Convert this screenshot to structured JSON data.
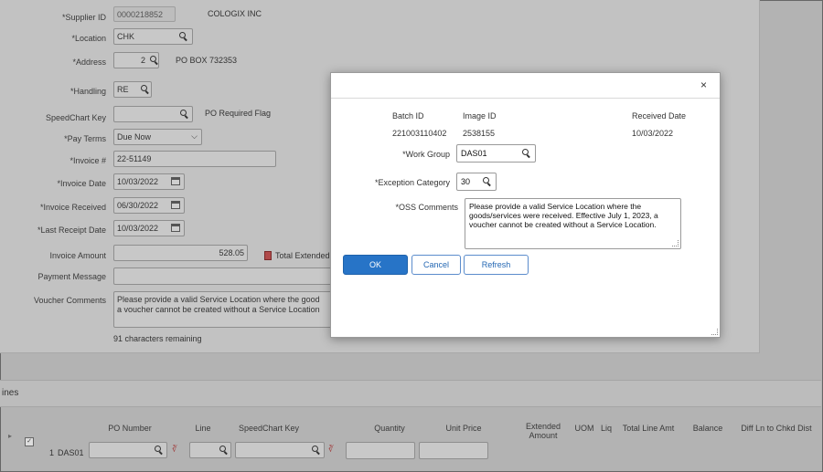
{
  "form": {
    "supplier_id_label": "*Supplier ID",
    "supplier_id": "0000218852",
    "supplier_name": "COLOGIX INC",
    "location_label": "*Location",
    "location": "CHK",
    "address_label": "*Address",
    "address_seq": "2",
    "address_text": "PO BOX 732353",
    "handling_label": "*Handling",
    "handling": "RE",
    "speedchart_label": "SpeedChart Key",
    "speedchart": "",
    "po_required_flag": "PO Required Flag",
    "pay_terms_label": "*Pay Terms",
    "pay_terms": "Due Now",
    "invoice_no_label": "*Invoice #",
    "invoice_no": "22-51149",
    "invoice_date_label": "*Invoice Date",
    "invoice_date": "10/03/2022",
    "invoice_received_label": "*Invoice Received",
    "invoice_received": "06/30/2022",
    "last_receipt_label": "*Last Receipt Date",
    "last_receipt": "10/03/2022",
    "invoice_amount_label": "Invoice Amount",
    "invoice_amount": "528.05",
    "total_extended": "Total Extended",
    "payment_message_label": "Payment Message",
    "payment_message": "",
    "voucher_comments_label": "Voucher Comments",
    "voucher_comments_line1": "Please provide a valid Service Location where the good",
    "voucher_comments_line2": "a voucher cannot be created without a Service Location",
    "chars_remaining": "91 characters remaining"
  },
  "lines": {
    "section_title": "ines",
    "headers": {
      "po_number": "PO Number",
      "line": "Line",
      "speedchart": "SpeedChart Key",
      "quantity": "Quantity",
      "unit_price": "Unit Price",
      "extended": "Extended",
      "amount": "Amount",
      "uom": "UOM",
      "liq": "Liq",
      "total_line_amt": "Total Line Amt",
      "balance": "Balance",
      "diff": "Diff Ln to Chkd Dist"
    },
    "row": {
      "num": "1",
      "group": "DAS01"
    }
  },
  "modal": {
    "batch_id_label": "Batch ID",
    "batch_id": "221003110402",
    "image_id_label": "Image ID",
    "image_id": "2538155",
    "received_date_label": "Received Date",
    "received_date": "10/03/2022",
    "work_group_label": "*Work Group",
    "work_group": "DAS01",
    "exception_category_label": "*Exception Category",
    "exception_category": "30",
    "oss_comments_label": "*OSS Comments",
    "oss_comments": "Please provide a valid Service Location where the goods/services were received.  Effective July 1, 2023, a voucher cannot be created without a Service Location.",
    "ok_label": "OK",
    "cancel_label": "Cancel",
    "refresh_label": "Refresh",
    "close_glyph": "×"
  }
}
